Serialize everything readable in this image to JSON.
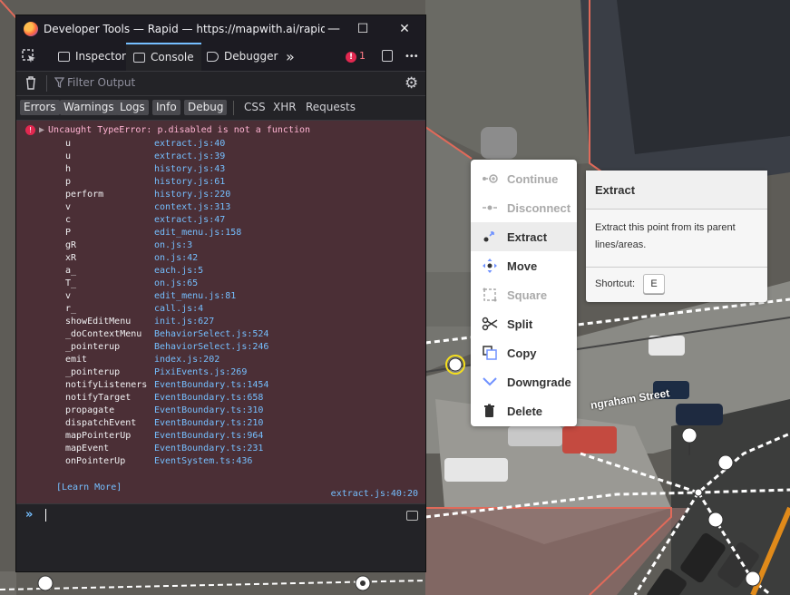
{
  "window": {
    "title": "Developer Tools — Rapid — https://mapwith.ai/rapid",
    "minimize_glyph": "—",
    "maximize_glyph": "☐",
    "close_glyph": "✕"
  },
  "tabs": [
    {
      "label": "Inspector",
      "icon": "inspector-icon"
    },
    {
      "label": "Console",
      "icon": "console-icon",
      "selected": true
    },
    {
      "label": "Debugger",
      "icon": "debugger-icon"
    }
  ],
  "more_tabs_glyph": "»",
  "error_count": "1",
  "menu_glyph": "•••",
  "filter": {
    "placeholder": "Filter Output"
  },
  "levels": [
    "Errors",
    "Warnings",
    "Logs",
    "Info",
    "Debug"
  ],
  "extra_filters": [
    "CSS",
    "XHR",
    "Requests"
  ],
  "error": {
    "message": "Uncaught TypeError: p.disabled is not a function",
    "stack": [
      {
        "fn": "u",
        "loc": "extract.js:40"
      },
      {
        "fn": "u",
        "loc": "extract.js:39"
      },
      {
        "fn": "h",
        "loc": "history.js:43"
      },
      {
        "fn": "p",
        "loc": "history.js:61"
      },
      {
        "fn": "perform",
        "loc": "history.js:220"
      },
      {
        "fn": "v",
        "loc": "context.js:313"
      },
      {
        "fn": "c",
        "loc": "extract.js:47"
      },
      {
        "fn": "P",
        "loc": "edit_menu.js:158"
      },
      {
        "fn": "gR",
        "loc": "on.js:3"
      },
      {
        "fn": "xR",
        "loc": "on.js:42"
      },
      {
        "fn": "a_",
        "loc": "each.js:5"
      },
      {
        "fn": "T_",
        "loc": "on.js:65"
      },
      {
        "fn": "v",
        "loc": "edit_menu.js:81"
      },
      {
        "fn": "r_",
        "loc": "call.js:4"
      },
      {
        "fn": "showEditMenu",
        "loc": "init.js:627"
      },
      {
        "fn": "_doContextMenu",
        "loc": "BehaviorSelect.js:524"
      },
      {
        "fn": "_pointerup",
        "loc": "BehaviorSelect.js:246"
      },
      {
        "fn": "emit",
        "loc": "index.js:202"
      },
      {
        "fn": "_pointerup",
        "loc": "PixiEvents.js:269"
      },
      {
        "fn": "notifyListeners",
        "loc": "EventBoundary.ts:1454"
      },
      {
        "fn": "notifyTarget",
        "loc": "EventBoundary.ts:658"
      },
      {
        "fn": "propagate",
        "loc": "EventBoundary.ts:310"
      },
      {
        "fn": "dispatchEvent",
        "loc": "EventBoundary.ts:210"
      },
      {
        "fn": "mapPointerUp",
        "loc": "EventBoundary.ts:964"
      },
      {
        "fn": "mapEvent",
        "loc": "EventBoundary.ts:231"
      },
      {
        "fn": "onPointerUp",
        "loc": "EventSystem.ts:436"
      }
    ],
    "learn_more": "[Learn More]",
    "source": "extract.js:40:20"
  },
  "console_prompt": "»",
  "context_menu": [
    {
      "label": "Continue",
      "icon": "continue-icon",
      "disabled": true
    },
    {
      "label": "Disconnect",
      "icon": "disconnect-icon",
      "disabled": true
    },
    {
      "label": "Extract",
      "icon": "extract-icon",
      "highlighted": true
    },
    {
      "label": "Move",
      "icon": "move-icon"
    },
    {
      "label": "Square",
      "icon": "square-icon",
      "disabled": true
    },
    {
      "label": "Split",
      "icon": "scissors-icon"
    },
    {
      "label": "Copy",
      "icon": "copy-icon"
    },
    {
      "label": "Downgrade",
      "icon": "chevron-down-icon"
    },
    {
      "label": "Delete",
      "icon": "trash-icon"
    }
  ],
  "tooltip": {
    "title": "Extract",
    "description": "Extract this point from its parent lines/areas.",
    "shortcut_label": "Shortcut:",
    "shortcut_key": "E"
  },
  "map": {
    "street_label": "ngraham Street"
  },
  "colors": {
    "accent": "#75bfff",
    "error_bg": "#4b2f36",
    "error_text": "#ffb3d2",
    "menu_icon": "#7092ff"
  }
}
